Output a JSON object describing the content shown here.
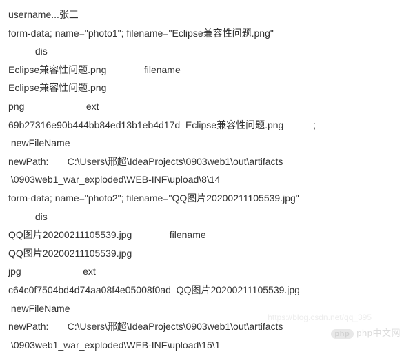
{
  "log": {
    "lines": [
      "username...张三",
      "form-data; name=\"photo1\"; filename=\"Eclipse兼容性问题.png\"",
      "          dis",
      "Eclipse兼容性问题.png              filename",
      "Eclipse兼容性问题.png",
      "png                       ext",
      "69b27316e90b444bb84ed13b1eb4d17d_Eclipse兼容性问题.png           ;",
      " newFileName",
      "newPath:       C:\\Users\\邢超\\IdeaProjects\\0903web1\\out\\artifacts",
      " \\0903web1_war_exploded\\WEB-INF\\upload\\8\\14",
      "form-data; name=\"photo2\"; filename=\"QQ图片20200211105539.jpg\"",
      "          dis",
      "QQ图片20200211105539.jpg              filename",
      "QQ图片20200211105539.jpg",
      "jpg                       ext",
      "c64c0f7504bd4d74aa08f4e05008f0ad_QQ图片20200211105539.jpg",
      " newFileName",
      "newPath:       C:\\Users\\邢超\\IdeaProjects\\0903web1\\out\\artifacts",
      " \\0903web1_war_exploded\\WEB-INF\\upload\\15\\1"
    ]
  },
  "watermark": {
    "brand": "php中文网",
    "faint_url": "https://blog.csdn.net/qq_395"
  }
}
